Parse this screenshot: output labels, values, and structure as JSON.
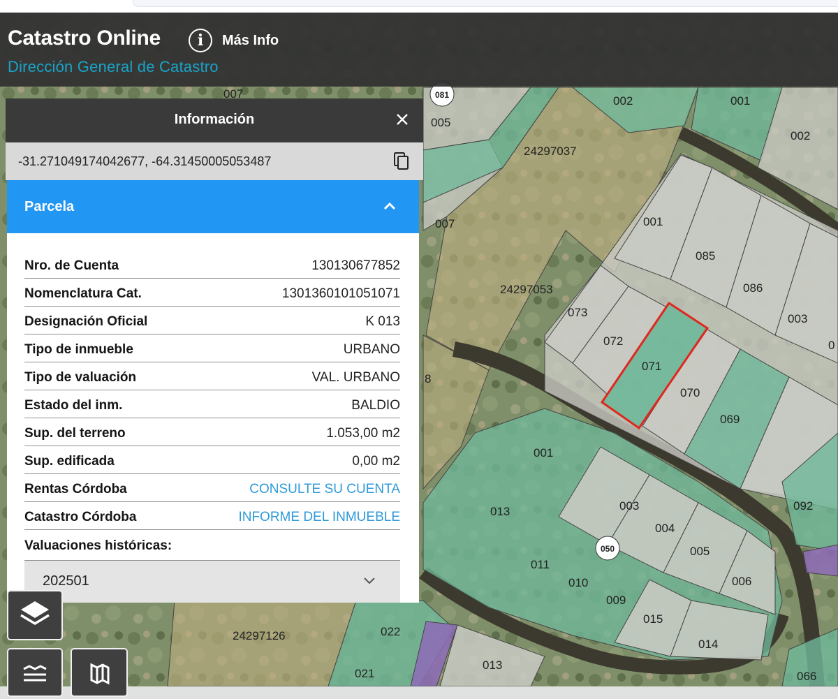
{
  "header": {
    "title": "Catastro Online",
    "subtitle": "Dirección General de Catastro",
    "info_label": "Más Info"
  },
  "panel": {
    "title": "Información",
    "coordinates": "-31.271049174042677, -64.31450005053487",
    "section_title": "Parcela",
    "rows": [
      {
        "label": "Nro. de Cuenta",
        "value": "130130677852"
      },
      {
        "label": "Nomenclatura Cat.",
        "value": "1301360101051071"
      },
      {
        "label": "Designación Oficial",
        "value": "K 013"
      },
      {
        "label": "Tipo de inmueble",
        "value": "URBANO"
      },
      {
        "label": "Tipo de valuación",
        "value": "VAL. URBANO"
      },
      {
        "label": "Estado del inm.",
        "value": "BALDIO"
      },
      {
        "label": "Sup. del terreno",
        "value": "1.053,00 m2"
      },
      {
        "label": "Sup. edificada",
        "value": "0,00 m2"
      },
      {
        "label": "Rentas Córdoba",
        "value": "CONSULTE SU CUENTA"
      },
      {
        "label": "Catastro Córdoba",
        "value": "INFORME DEL INMUEBLE"
      }
    ],
    "history_label": "Valuaciones históricas:",
    "history_selected": "202501"
  },
  "map": {
    "parcel_labels": [
      "007",
      "081",
      "005",
      "002",
      "001",
      "002",
      "24297037",
      "007",
      "001",
      "085",
      "086",
      "003",
      "24297053",
      "073",
      "072",
      "071",
      "070",
      "069",
      "0",
      "001",
      "013",
      "003",
      "004",
      "005",
      "006",
      "092",
      "050",
      "011",
      "010",
      "009",
      "015",
      "014",
      "24297126",
      "022",
      "021",
      "013",
      "066",
      "8"
    ],
    "selected_parcel": "071"
  },
  "colors": {
    "header_bg": "#303030",
    "subtitle": "#19a3c8",
    "accent_blue": "#2196f3",
    "link": "#2f9ad8",
    "selected_outline": "#e0271d",
    "parcel_green": "#6fb89a",
    "parcel_gray": "#c9cbc4"
  },
  "icons": [
    "info-icon",
    "close-icon",
    "copy-icon",
    "chevron-up-icon",
    "chevron-down-icon",
    "layers-icon",
    "legend-icon",
    "basemap-icon"
  ]
}
